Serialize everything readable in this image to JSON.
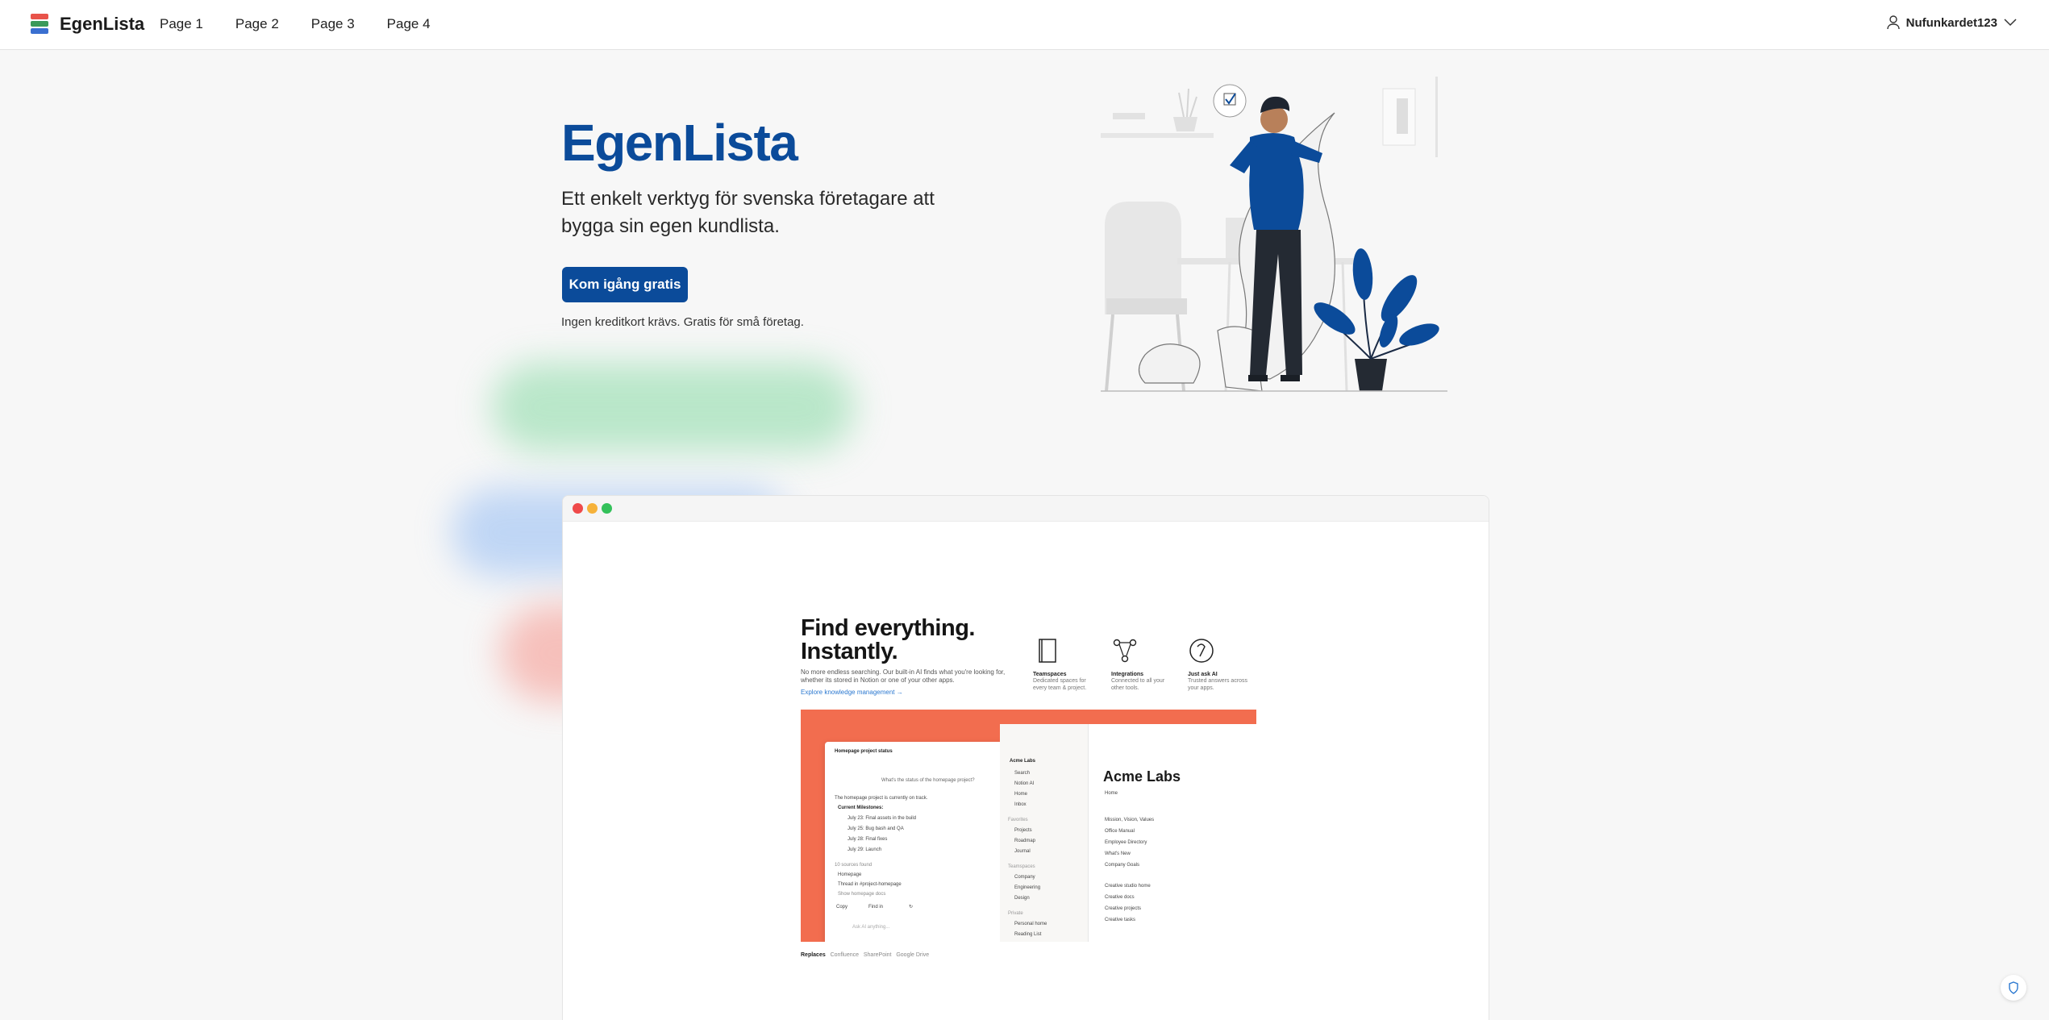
{
  "header": {
    "brand": "EgenLista",
    "nav": [
      {
        "label": "Page 1"
      },
      {
        "label": "Page 2"
      },
      {
        "label": "Page 3"
      },
      {
        "label": "Page 4"
      }
    ],
    "user": "Nufunkardet123"
  },
  "hero": {
    "title": "EgenLista",
    "subtitle": "Ett enkelt verktyg för svenska företagare att bygga sin egen kundlista.",
    "cta": "Kom igång gratis",
    "note": "Ingen kreditkort krävs. Gratis för små företag."
  },
  "preview": {
    "title_line1": "Find everything.",
    "title_line2": "Instantly.",
    "description": "No more endless searching. Our built-in AI finds what you're looking for, whether its stored in Notion or one of your other apps.",
    "link": "Explore knowledge management →",
    "features": [
      {
        "title": "Teamspaces",
        "desc": "Dedicated spaces for every team & project.",
        "icon": "book-icon"
      },
      {
        "title": "Integrations",
        "desc": "Connected to all your other tools.",
        "icon": "nodes-icon"
      },
      {
        "title": "Just ask AI",
        "desc": "Trusted answers across your apps.",
        "icon": "ai-face-icon"
      }
    ],
    "chat": {
      "header": "Homepage project status",
      "question": "What's the status of the homepage project?",
      "answer": "The homepage project is currently on track.",
      "milestones_label": "Current Milestones:",
      "milestones": [
        "July 23: Final assets in the build",
        "July 25: Bug bash and QA",
        "July 28: Final fixes",
        "July 29: Launch"
      ],
      "sources_label": "10 sources found",
      "sources": [
        "Homepage",
        "Thread in #project-homepage",
        "Show homepage docs"
      ],
      "actions": [
        "Copy",
        "Find in",
        "↻"
      ],
      "input_placeholder": "Ask AI anything..."
    },
    "sidebar": {
      "workspace": "Acme Labs",
      "top": [
        "Search",
        "Notion AI",
        "Home",
        "Inbox"
      ],
      "favorites_label": "Favorites",
      "favorites": [
        "Projects",
        "Roadmap",
        "Journal"
      ],
      "teamspaces_label": "Teamspaces",
      "teamspaces": [
        "Company",
        "Engineering",
        "Design"
      ],
      "private_label": "Private",
      "private": [
        "Personal home",
        "Reading List"
      ]
    },
    "main": {
      "title": "Acme Labs",
      "breadcrumb": "Home",
      "links": [
        "Mission, Vision, Values",
        "Office Manual",
        "Employee Directory",
        "What's New",
        "Company Goals"
      ],
      "links2": [
        "Creative studio home",
        "Creative docs",
        "Creative projects",
        "Creative tasks"
      ]
    },
    "replaces_label": "Replaces",
    "replaces": [
      "Confluence",
      "SharePoint",
      "Google Drive"
    ]
  },
  "colors": {
    "brand_blue": "#0b4b9a",
    "accent_orange": "#f26d4f"
  }
}
